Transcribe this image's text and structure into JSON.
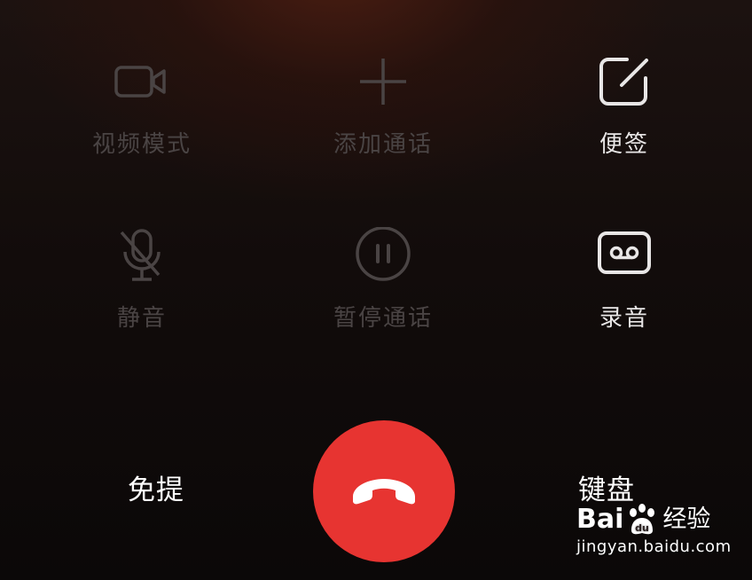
{
  "actions": [
    {
      "label": "视频模式",
      "icon": "video-camera-icon",
      "enabled": false
    },
    {
      "label": "添加通话",
      "icon": "plus-icon",
      "enabled": false
    },
    {
      "label": "便签",
      "icon": "note-edit-icon",
      "enabled": true
    },
    {
      "label": "静音",
      "icon": "mic-off-icon",
      "enabled": false
    },
    {
      "label": "暂停通话",
      "icon": "pause-icon",
      "enabled": false
    },
    {
      "label": "录音",
      "icon": "record-tape-icon",
      "enabled": true
    }
  ],
  "bottom": {
    "speaker_label": "免提",
    "keypad_label": "键盘",
    "end_call_icon": "phone-hangup-icon"
  },
  "colors": {
    "end_call": "#e73431",
    "disabled": "#4a4444",
    "enabled": "#e8e6e6"
  },
  "watermark": {
    "brand_left": "Bai",
    "brand_right": "经验",
    "url": "jingyan.baidu.com"
  }
}
